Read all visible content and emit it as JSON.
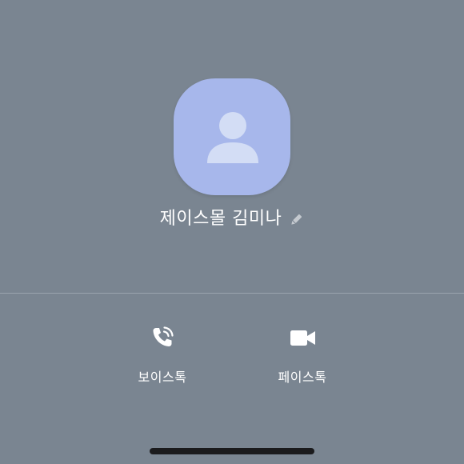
{
  "contact": {
    "name": "제이스몰 김미나"
  },
  "actions": [
    {
      "label": "보이스톡",
      "icon": "phone-ringing-icon"
    },
    {
      "label": "페이스톡",
      "icon": "video-camera-icon"
    }
  ],
  "colors": {
    "background": "#7a8591",
    "avatar": "#a7b7eb",
    "avatar_figure": "#d3ddf5",
    "text": "#ffffff",
    "edit_icon": "#c4c9cf",
    "divider": "#9aa3ad",
    "home_indicator": "#1b1b1d"
  }
}
